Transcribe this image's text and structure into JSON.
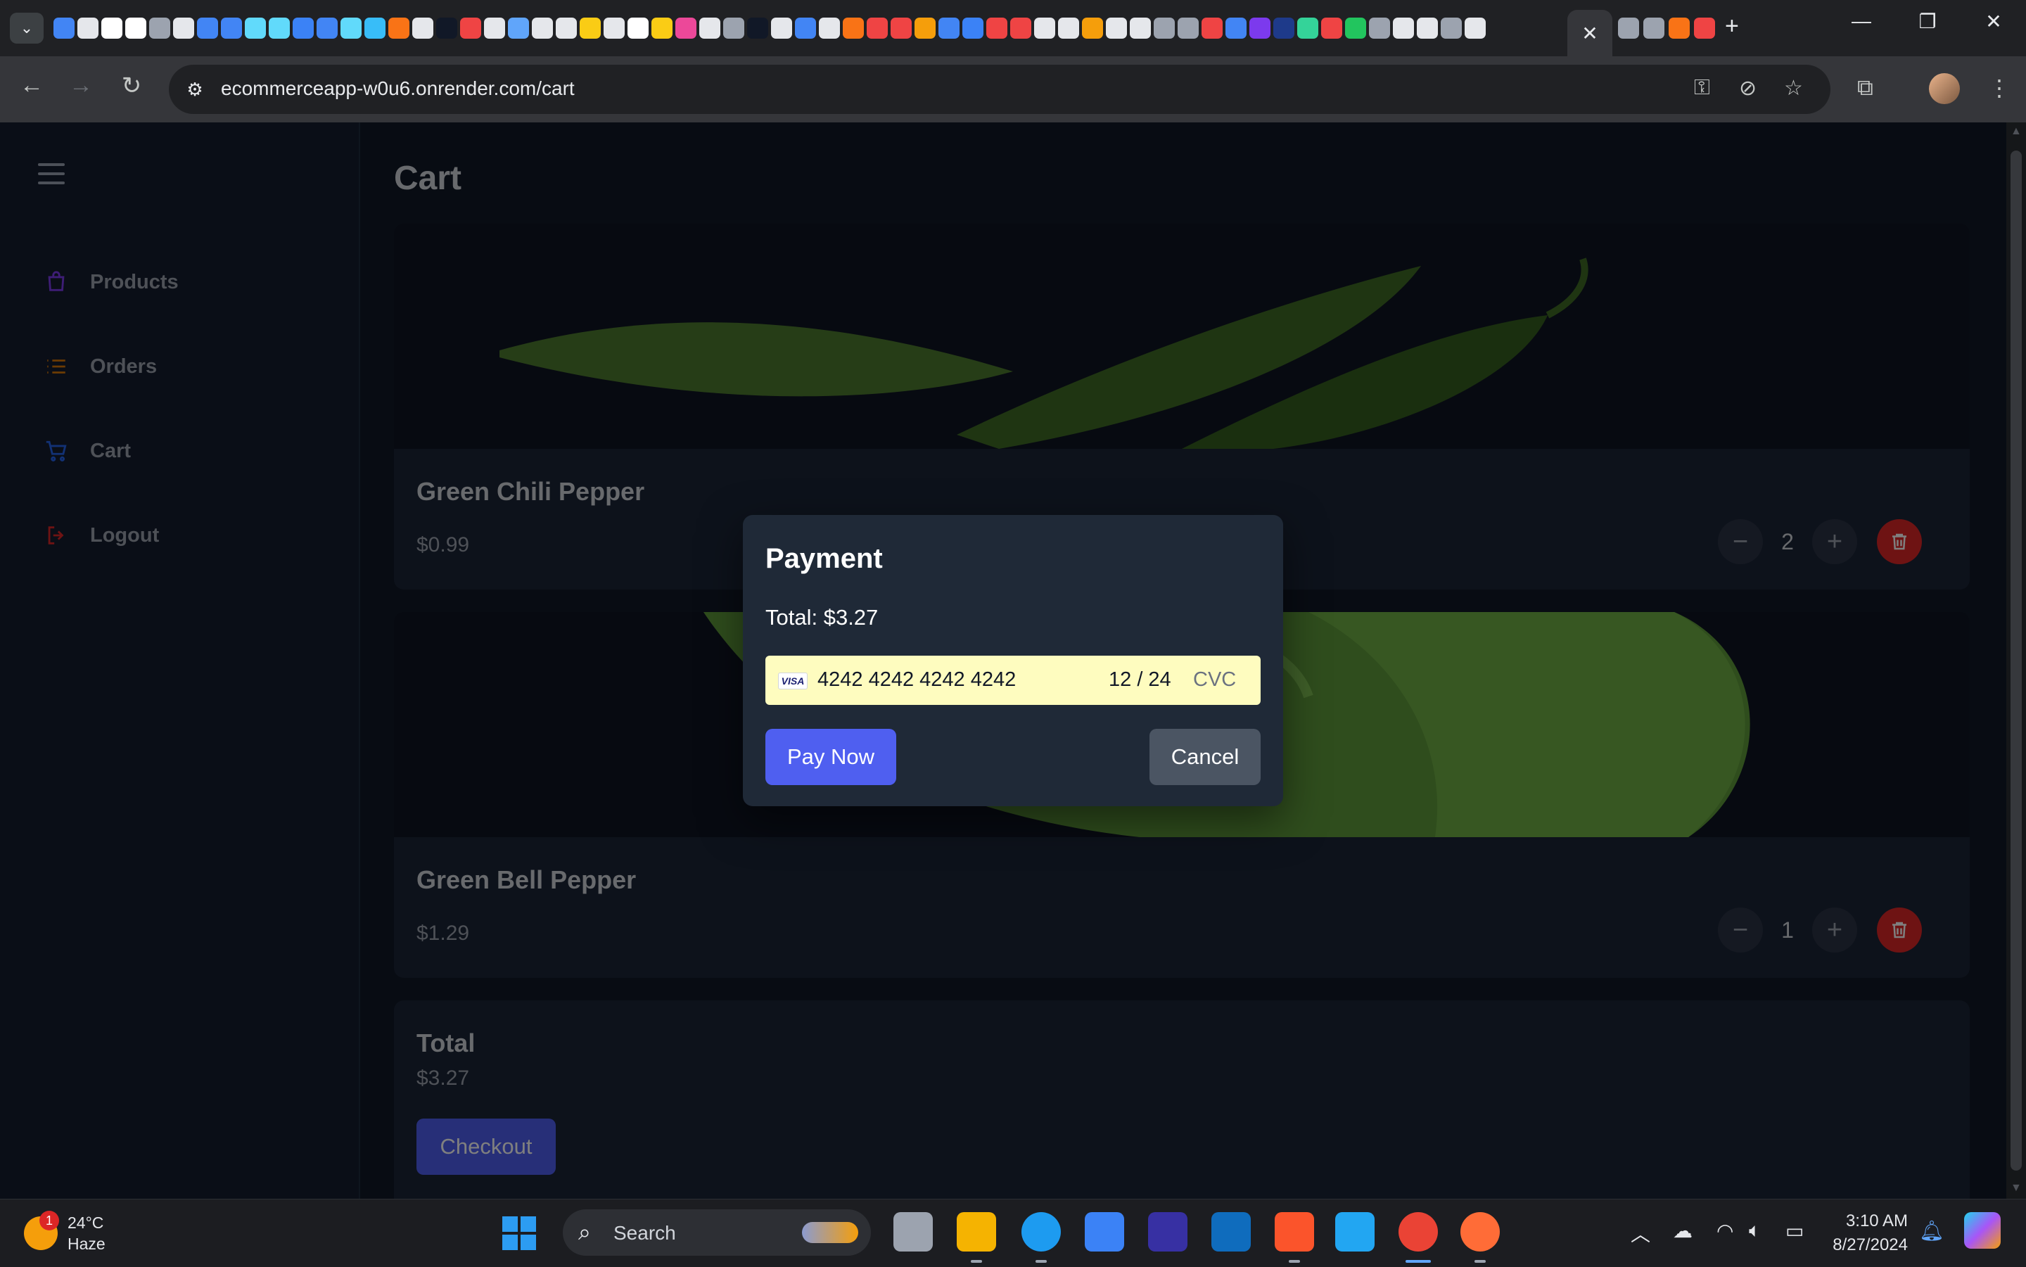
{
  "browser": {
    "url": "ecommerceapp-w0u6.onrender.com/cart",
    "active_tab_close": "✕",
    "new_tab": "+",
    "favicon_colors": [
      "#4285f4",
      "#e5e7eb",
      "#ffffff",
      "#ffffff",
      "#9ca3af",
      "#e5e7eb",
      "#4285f4",
      "#4285f4",
      "#61dafb",
      "#61dafb",
      "#3b82f6",
      "#4285f4",
      "#61dafb",
      "#38bdf8",
      "#f97316",
      "#e5e7eb",
      "#111827",
      "#ef4444",
      "#e5e7eb",
      "#60a5fa",
      "#e5e7eb",
      "#e5e7eb",
      "#facc15",
      "#e5e7eb",
      "#ffffff",
      "#facc15",
      "#ec4899",
      "#e5e7eb",
      "#9ca3af",
      "#111827",
      "#e5e7eb",
      "#4285f4",
      "#e5e7eb",
      "#f97316",
      "#ef4444",
      "#ef4444",
      "#f59e0b",
      "#4285f4",
      "#3b82f6",
      "#ef4444",
      "#ef4444",
      "#e5e7eb",
      "#e5e7eb",
      "#f59e0b",
      "#e5e7eb",
      "#e5e7eb",
      "#9ca3af",
      "#9ca3af",
      "#ef4444",
      "#4285f4",
      "#7c3aed",
      "#1e3a8a",
      "#34d399",
      "#ef4444",
      "#22c55e",
      "#9ca3af",
      "#e5e7eb",
      "#e5e7eb",
      "#9ca3af",
      "#e5e7eb"
    ]
  },
  "sidebar": {
    "items": [
      {
        "label": "Products",
        "icon": "shopping-bag-icon",
        "color": "#7c3aed"
      },
      {
        "label": "Orders",
        "icon": "list-icon",
        "color": "#d97706"
      },
      {
        "label": "Cart",
        "icon": "cart-icon",
        "color": "#2563eb"
      },
      {
        "label": "Logout",
        "icon": "logout-icon",
        "color": "#dc2626"
      }
    ]
  },
  "cart": {
    "title": "Cart",
    "items": [
      {
        "name": "Green Chili Pepper",
        "price": "$0.99",
        "quantity": "2"
      },
      {
        "name": "Green Bell Pepper",
        "price": "$1.29",
        "quantity": "1"
      }
    ],
    "total_label": "Total",
    "total_value": "$3.27",
    "checkout_label": "Checkout"
  },
  "payment_modal": {
    "title": "Payment",
    "total_text": "Total: $3.27",
    "card_brand": "VISA",
    "card_number": "4242 4242 4242 4242",
    "expiry": "12 / 24",
    "cvc_placeholder": "CVC",
    "pay_label": "Pay Now",
    "cancel_label": "Cancel"
  },
  "taskbar": {
    "temperature": "24°C",
    "condition": "Haze",
    "notification_count": "1",
    "search_label": "Search",
    "time": "3:10 AM",
    "date": "8/27/2024",
    "pinned_apps": [
      "task-view",
      "file-explorer",
      "edge",
      "store",
      "app-m",
      "outlook",
      "brave",
      "vscode",
      "chrome",
      "app-pen"
    ]
  },
  "colors": {
    "accent": "#4f5ff0",
    "danger": "#dc2626",
    "app_bg": "#111827",
    "card_bg": "#1b2436",
    "modal_bg": "#1f2937",
    "card_input_bg": "#fefcbf"
  }
}
